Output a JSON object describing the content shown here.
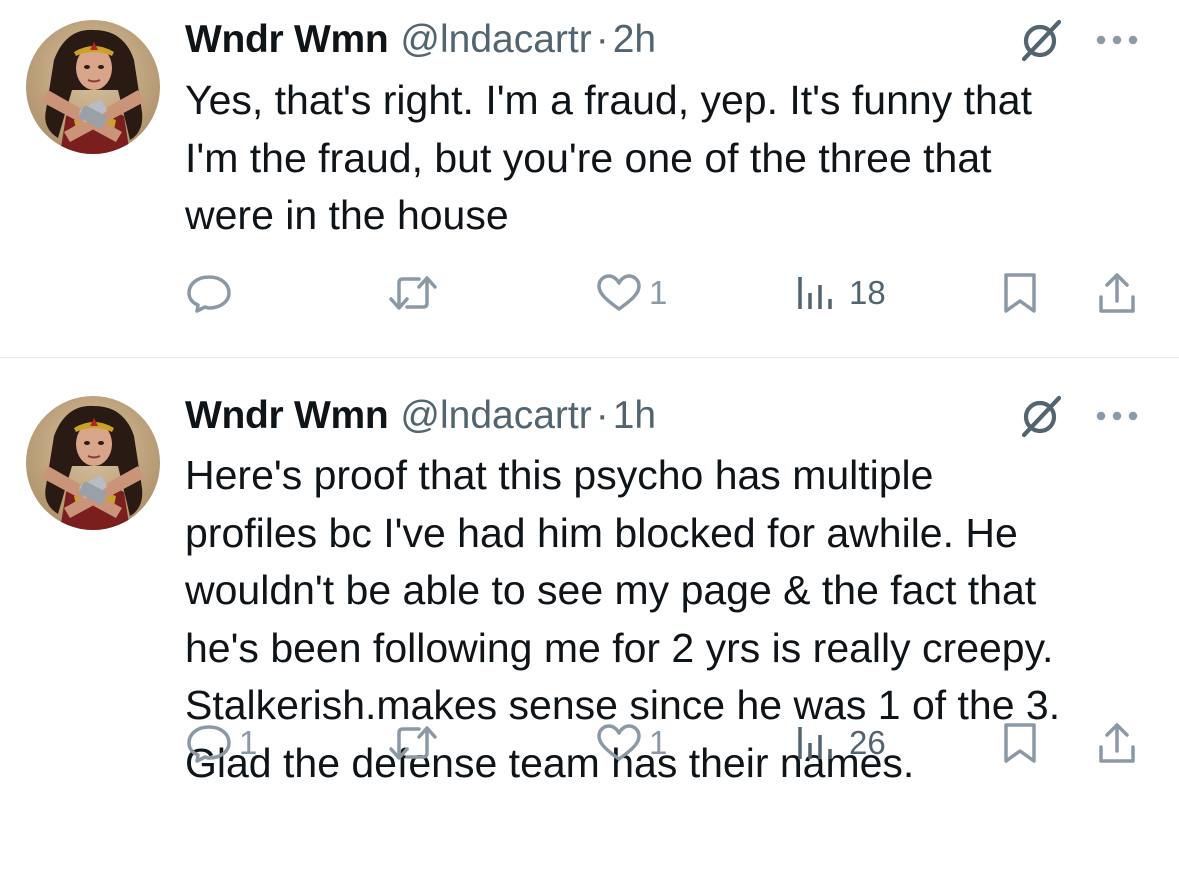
{
  "colors": {
    "text": "#0f1419",
    "secondary": "#536471",
    "action_icon": "#8b98a5",
    "divider": "#e6e9ec"
  },
  "tweets": [
    {
      "name": "Wndr Wmn",
      "handle": "@lndacartr",
      "separator": "·",
      "time": "2h",
      "text": "Yes, that's right. I'm a fraud, yep. It's funny that\nI'm the fraud, but you're one of the three that\nwere in the house",
      "reply_count": "",
      "retweet_count": "",
      "like_count": "1",
      "view_count": "18",
      "icons": [
        "reply-icon",
        "retweet-icon",
        "like-icon",
        "views-icon",
        "bookmark-icon",
        "share-icon"
      ]
    },
    {
      "name": "Wndr Wmn",
      "handle": "@lndacartr",
      "separator": "·",
      "time": "1h",
      "text": "Here's proof that this psycho has multiple\nprofiles bc I've had him blocked for awhile. He\nwouldn't be able to see my page & the fact that\nhe's been following me for 2 yrs is really creepy.\nStalkerish.makes sense since he was 1 of the 3.\nGlad the defense team has their names.",
      "reply_count": "1",
      "retweet_count": "",
      "like_count": "1",
      "view_count": "26",
      "icons": [
        "reply-icon",
        "retweet-icon",
        "like-icon",
        "views-icon",
        "bookmark-icon",
        "share-icon"
      ]
    }
  ]
}
